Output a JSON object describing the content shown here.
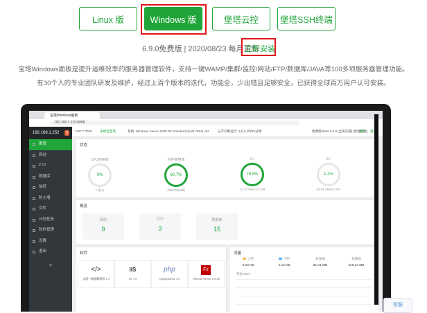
{
  "tabs": [
    {
      "label": "Linux 版",
      "active": false
    },
    {
      "label": "Windows 版",
      "active": true
    },
    {
      "label": "堡塔云控",
      "active": false
    },
    {
      "label": "堡塔SSH终端",
      "active": false
    }
  ],
  "version": {
    "text": "6.9.0免费版 | 2020/08/23 每月更新",
    "install": "立即安装"
  },
  "description": {
    "line1": "宝塔Windows面板是提升运维效率的服务器管理软件，支持一键WAMP/集群/监控/网站/FTP/数据库/JAVA等100多项服务器管理功能。",
    "line2": "有30个人的专业团队研发及维护，经过上百个版本的迭代，功能全，少出错且足够安全，已获得全球百万用户认可安装。"
  },
  "panel": {
    "browser_tab": "宝塔Windows面板",
    "address": "192.168.1.129:8888",
    "sidebar": {
      "ip": "192.168.1.252",
      "badge": "0",
      "items": [
        "首页",
        "网站",
        "FTP",
        "数据库",
        "监控",
        "防火墙",
        "文件",
        "计划任务",
        "软件管理",
        "设置",
        "退出"
      ],
      "plus": "+"
    },
    "topbar": {
      "user": "138****7535",
      "bind": "未绑定宝塔",
      "system": "系统: Windows Server 2008 R2 Standard (build 7601) x64",
      "uptime": "已不间断运行: 1天1小时33分钟",
      "version": "免费版 Beta 6.0.0 [立即升级] [修复面板]",
      "repair": "更新",
      "restart": "重启"
    },
    "status": {
      "title": "状态",
      "gauges": [
        {
          "label": "CPU使用率",
          "value": "0%",
          "sub": "1 核心"
        },
        {
          "label": "内存使用率",
          "value": "60.7%",
          "sub": "465/799(MB)"
        },
        {
          "label": "C:/",
          "value": "78.8%",
          "sub": "11.74 GB/14.9 GB"
        },
        {
          "label": "E:/",
          "value": "1.2%",
          "sub": "59.51 MB/5.0 GB"
        }
      ]
    },
    "overview": {
      "title": "概览",
      "items": [
        {
          "label": "网站",
          "value": "9"
        },
        {
          "label": "FTP",
          "value": "3"
        },
        {
          "label": "数据库",
          "value": "15"
        }
      ]
    },
    "software": {
      "title": "软件",
      "items": [
        {
          "icon": "</>",
          "name": "宝塔一键部署源码 1.0"
        },
        {
          "icon": "IIS",
          "name": "IIS 7.5"
        },
        {
          "icon": "php",
          "name": "phpMyAdmin 4.4"
        },
        {
          "icon": "Fz",
          "name": "FileZilla Server 0.9.60"
        }
      ]
    },
    "traffic": {
      "title": "流量",
      "cols": [
        {
          "key": "上行",
          "value": "0.63 KB"
        },
        {
          "key": "下行",
          "value": "2.15 KB"
        },
        {
          "key": "总发送",
          "value": "81.01 MB"
        },
        {
          "key": "总接收",
          "value": "448.24 MB"
        }
      ],
      "unit": "单位:KB/s",
      "upColor": "#f7b851",
      "downColor": "#52a9ff"
    }
  },
  "help": "客服"
}
